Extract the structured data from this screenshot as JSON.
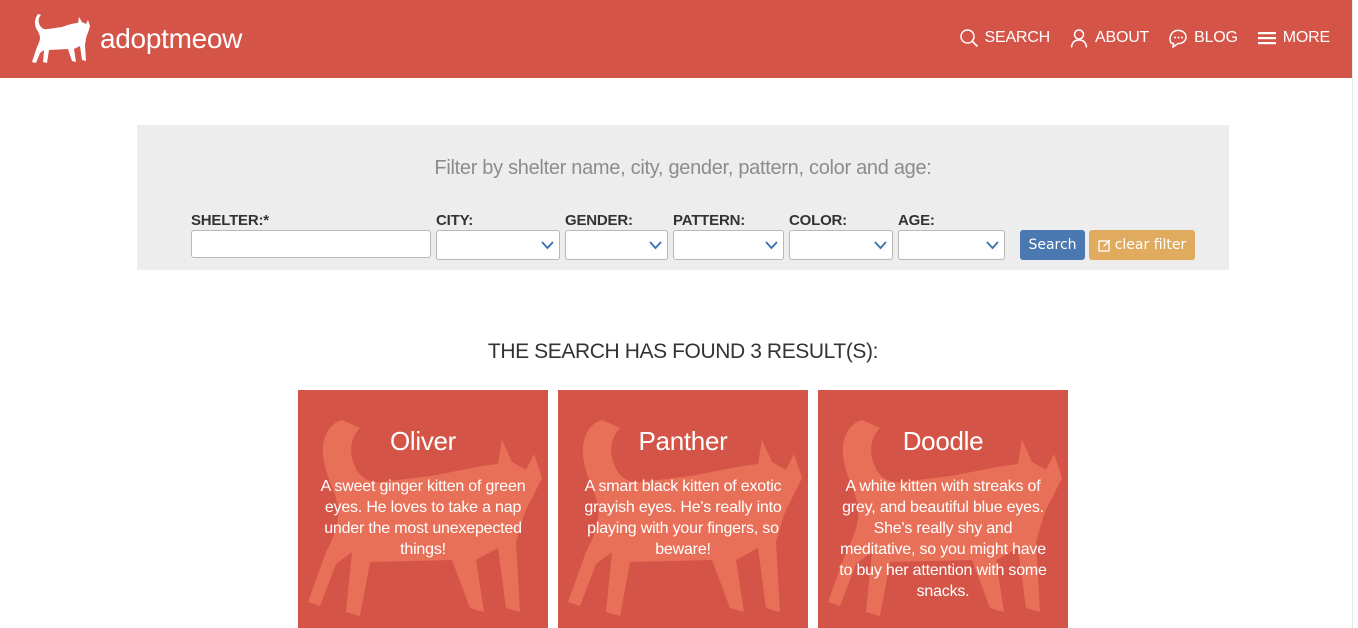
{
  "brand": {
    "name": "adoptmeow"
  },
  "nav": {
    "search": "SEARCH",
    "about": "ABOUT",
    "blog": "BLOG",
    "more": "MORE"
  },
  "filter": {
    "title": "Filter by shelter name, city, gender, pattern, color and age:",
    "shelter_label": "SHELTER:*",
    "shelter_value": "",
    "city_label": "CITY:",
    "gender_label": "GENDER:",
    "pattern_label": "PATTERN:",
    "color_label": "COLOR:",
    "age_label": "AGE:",
    "search_button": "Search",
    "clear_button": "clear filter"
  },
  "results": {
    "heading": "THE SEARCH HAS FOUND 3 RESULT(S):",
    "cards": [
      {
        "name": "Oliver",
        "description": "A sweet ginger kitten of green eyes. He loves to take a nap under the most unexepected things!"
      },
      {
        "name": "Panther",
        "description": "A smart black kitten of exotic grayish eyes. He's really into playing with your fingers, so beware!"
      },
      {
        "name": "Doodle",
        "description": "A white kitten with streaks of grey, and beautiful blue eyes. She's really shy and meditative, so you might have to buy her attention with some snacks."
      }
    ]
  },
  "colors": {
    "brand_red": "#d55448",
    "cat_silhouette": "#e87058",
    "search_blue": "#4a78b0",
    "clear_orange": "#e0aa5f",
    "panel_gray": "#ededed"
  },
  "icons": {
    "logo": "cat-silhouette-icon",
    "search": "magnifier-icon",
    "about": "user-icon",
    "blog": "chat-bubble-icon",
    "more": "hamburger-icon",
    "select": "chevron-down-icon",
    "clear": "edit-icon"
  }
}
